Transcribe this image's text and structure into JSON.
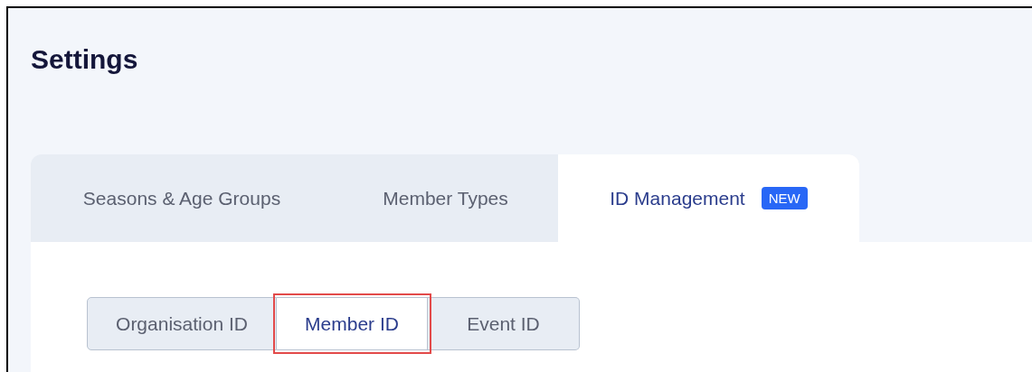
{
  "page": {
    "title": "Settings"
  },
  "tabs": [
    {
      "label": "Seasons & Age Groups",
      "selected": false
    },
    {
      "label": "Member Types",
      "selected": false
    },
    {
      "label": "ID Management",
      "selected": true,
      "badge": "NEW"
    }
  ],
  "segments": [
    {
      "label": "Organisation ID",
      "selected": false,
      "highlighted": false
    },
    {
      "label": "Member ID",
      "selected": true,
      "highlighted": true
    },
    {
      "label": "Event ID",
      "selected": false,
      "highlighted": false
    }
  ]
}
